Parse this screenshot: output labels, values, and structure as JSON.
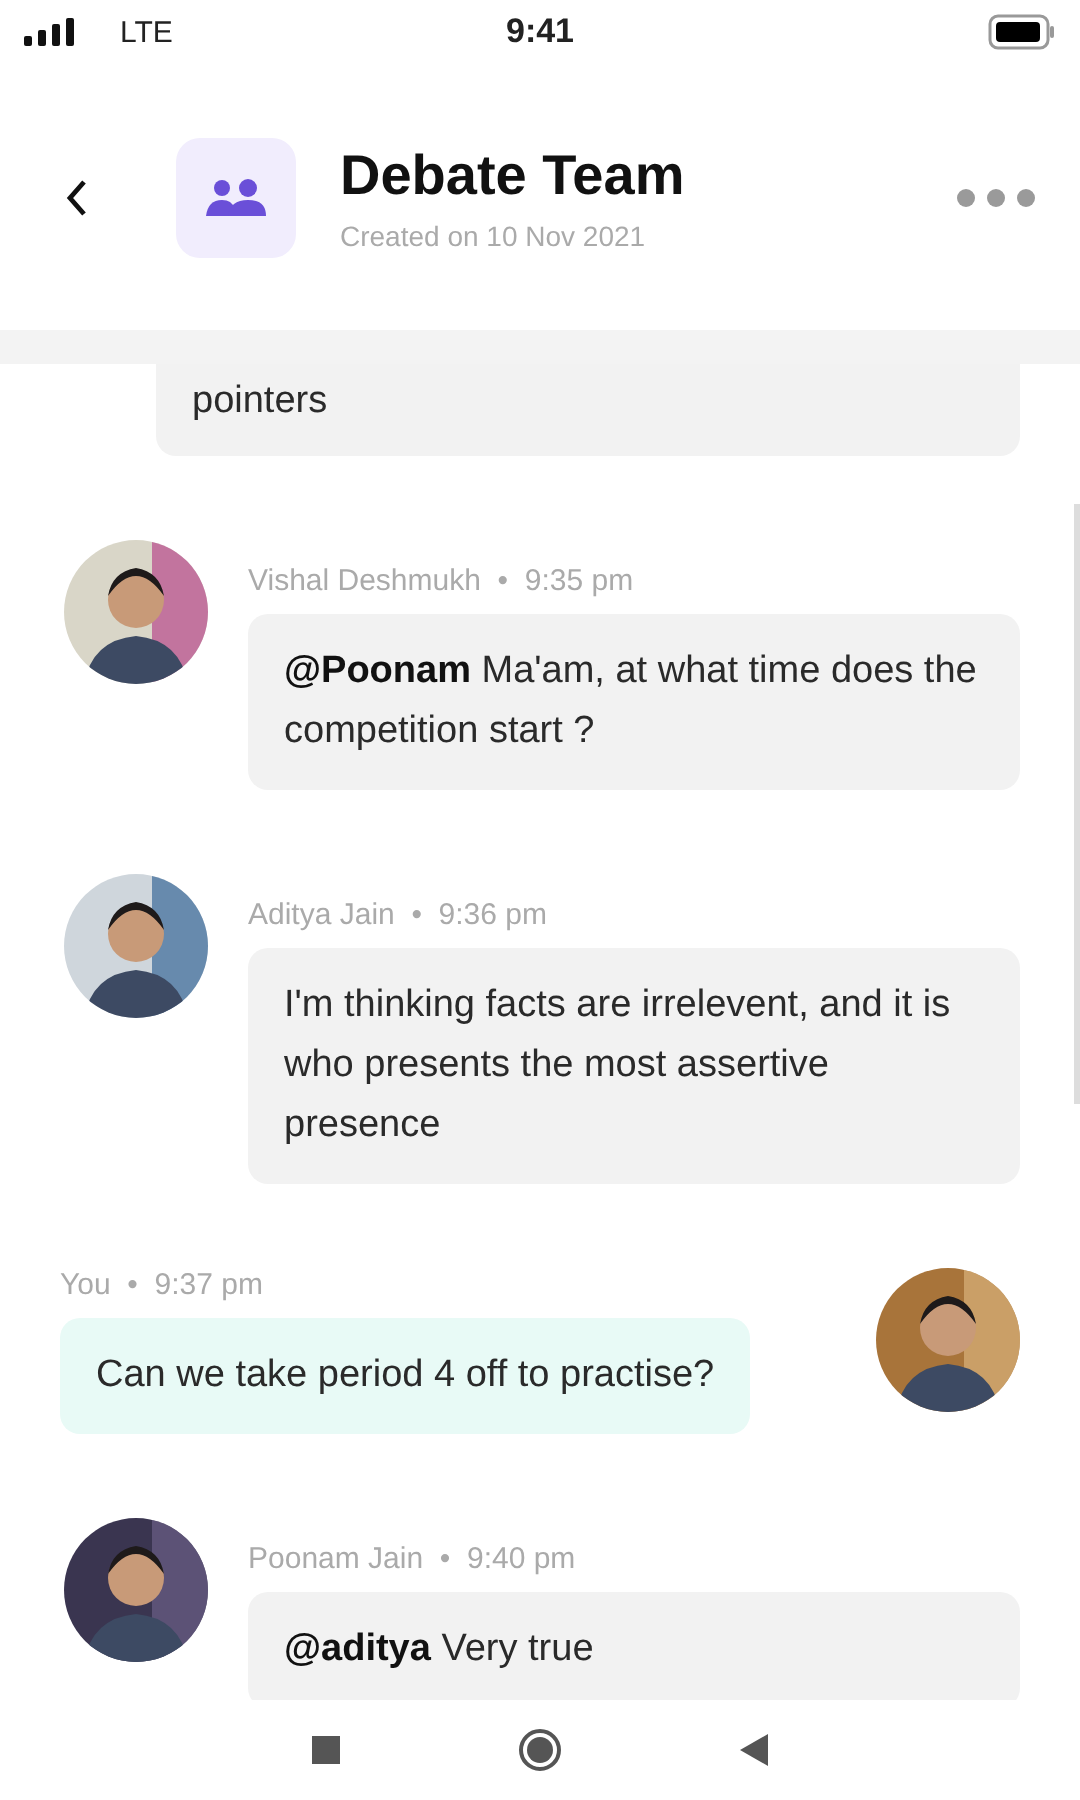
{
  "status_bar": {
    "network": "LTE",
    "time": "9:41"
  },
  "header": {
    "title": "Debate Team",
    "subtitle": "Created on 10 Nov 2021"
  },
  "messages": [
    {
      "kind": "partial",
      "text": "pointers"
    },
    {
      "kind": "other",
      "meta": "Vishal Deshmukh  •  9:35 pm",
      "text": "**@Poonam** Ma'am, at what time does the competition start ?"
    },
    {
      "kind": "other",
      "meta": "Aditya Jain  •  9:36 pm",
      "text": "I'm thinking facts are irrelevent, and it is who presents the most assertive presence"
    },
    {
      "kind": "self",
      "meta": "You  •  9:37 pm",
      "text": "Can we take period 4 off to practise?"
    },
    {
      "kind": "other",
      "meta": "Poonam Jain  •  9:40 pm",
      "text": "**@aditya** Very true"
    }
  ]
}
